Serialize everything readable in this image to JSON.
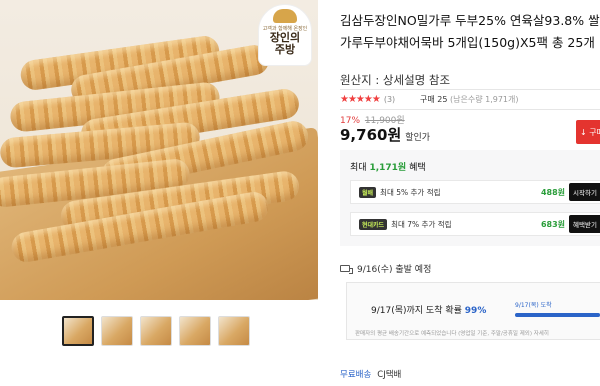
{
  "gallery": {
    "badge": {
      "small": "고객과 함께해 온장인",
      "big": "장인의\n주방"
    },
    "thumbnails": [
      "thumb-1",
      "thumb-2",
      "thumb-3",
      "thumb-4",
      "thumb-5"
    ],
    "active_index": 0
  },
  "product": {
    "title": "김삼두장인NO밀가루 두부25% 연육살93.8% 쌀가루두부야채어묵바 5개입(150g)X5팩 총 25개",
    "origin": "원산지 : 상세설명 참조",
    "rating": {
      "stars": "★★★★★",
      "count": "(3)"
    },
    "sold": {
      "label": "구매 25",
      "remaining": "(남은수량 1,971개)"
    },
    "discount": {
      "percent": "17%",
      "original": "11,900원"
    },
    "price": {
      "value": "9,760원",
      "suffix": "할인가"
    },
    "buy_button": "↓ 구매하기"
  },
  "benefits": {
    "header_prefix": "최대",
    "header_amount": "1,171원",
    "header_suffix": "혜택",
    "rows": [
      {
        "tag": "월배",
        "text": "최대 5% 추가 적립",
        "amount": "488원",
        "button": "시작하기"
      },
      {
        "tag": "현대카드",
        "text": "최대 7% 추가 적립",
        "amount": "683원",
        "button": "혜택받기"
      }
    ]
  },
  "shipping": {
    "departure": "9/16(수) 출발 예정",
    "arrival_prefix": "9/17(목)까지 도착 확률",
    "arrival_prob": "99%",
    "arrival_probability_fraction": 0.99,
    "day_label": "9/17(목) 도착",
    "note": "판매자의 평균 배송기간으로 예측되었습니다 (영업일 기준, 주말/공휴일 제외) 자세히",
    "free_label": "무료배송",
    "carrier": "CJ택배"
  },
  "colors": {
    "accent_red": "#e4342f",
    "accent_blue": "#2b64c8",
    "accent_green": "#2a9d3a"
  }
}
